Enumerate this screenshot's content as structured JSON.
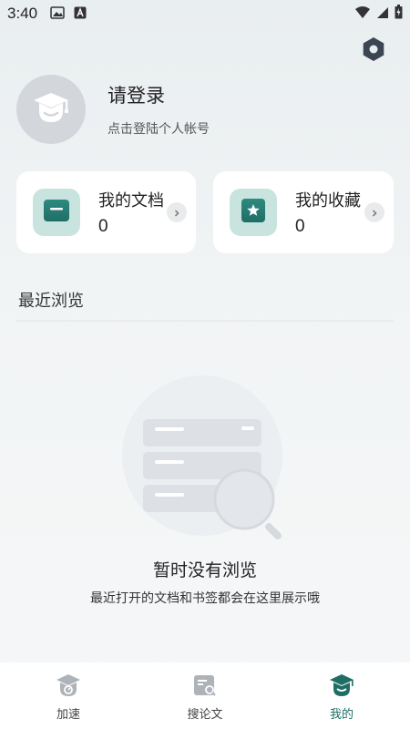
{
  "status_bar": {
    "time": "3:40",
    "left_icons": [
      "image-icon",
      "a-icon"
    ],
    "right_icons": [
      "wifi-icon",
      "signal-icon",
      "battery-icon"
    ]
  },
  "settings": {
    "icon": "settings-hex-icon"
  },
  "profile": {
    "title": "请登录",
    "subtitle": "点击登陆个人帐号",
    "avatar_icon": "graduation-cap-icon"
  },
  "cards": {
    "docs": {
      "title": "我的文档",
      "count": "0",
      "icon": "folder-icon"
    },
    "favs": {
      "title": "我的收藏",
      "count": "0",
      "icon": "star-icon"
    }
  },
  "recent": {
    "title": "最近浏览",
    "empty_title": "暂时没有浏览",
    "empty_subtitle": "最近打开的文档和书签都会在这里展示哦"
  },
  "nav": {
    "items": [
      {
        "label": "加速",
        "icon": "speed-cap-icon",
        "active": false
      },
      {
        "label": "搜论文",
        "icon": "search-doc-icon",
        "active": false
      },
      {
        "label": "我的",
        "icon": "mine-cap-icon",
        "active": true
      }
    ]
  },
  "colors": {
    "accent": "#1f6e66",
    "card_icon_bg": "#c9e3df",
    "avatar_bg": "#d3d7dc",
    "settings_icon": "#3c4652"
  }
}
